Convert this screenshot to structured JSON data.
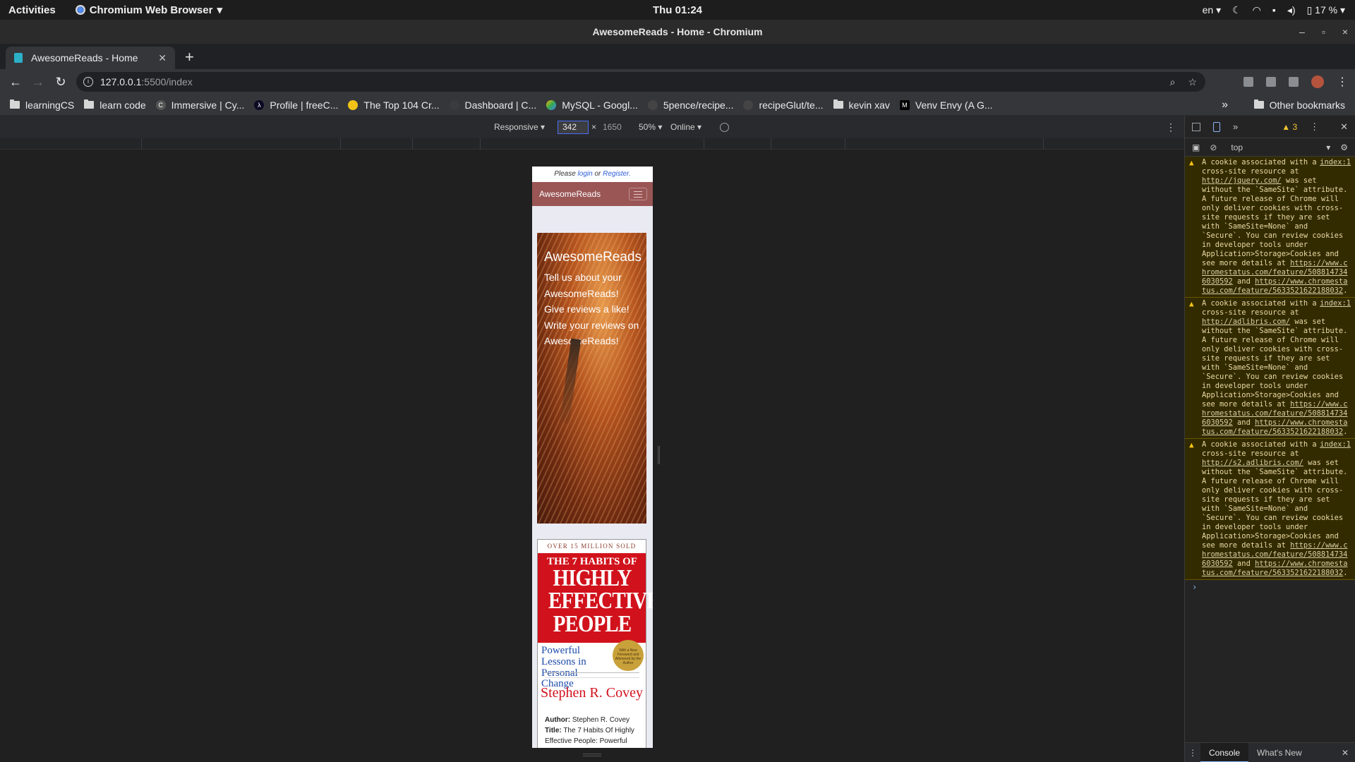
{
  "topbar": {
    "activities": "Activities",
    "app_name": "Chromium Web Browser",
    "clock": "Thu 01:24",
    "language": "en",
    "battery": "17 %"
  },
  "window": {
    "title": "AwesomeReads - Home - Chromium"
  },
  "tabs": [
    {
      "title": "AwesomeReads - Home",
      "active": true
    }
  ],
  "toolbar": {
    "url_host": "127.0.0.1",
    "url_path": ":5500/index"
  },
  "bookmarks": {
    "items": [
      {
        "label": "learningCS",
        "icon": "folder-icon"
      },
      {
        "label": "learn code",
        "icon": "folder-icon"
      },
      {
        "label": "Immersive | Cy...",
        "icon": "site-icon"
      },
      {
        "label": "Profile | freeC...",
        "icon": "freecodecamp-icon"
      },
      {
        "label": "The Top 104 Cr...",
        "icon": "emoji-icon"
      },
      {
        "label": "Dashboard | C...",
        "icon": "site-icon"
      },
      {
        "label": "MySQL - Googl...",
        "icon": "google-drive-icon"
      },
      {
        "label": "5pence/recipe...",
        "icon": "github-icon"
      },
      {
        "label": "recipeGlut/te...",
        "icon": "github-icon"
      },
      {
        "label": "kevin xav",
        "icon": "folder-icon"
      },
      {
        "label": "Venv Envy (A G...",
        "icon": "medium-icon"
      }
    ],
    "overflow": "»",
    "other": "Other bookmarks"
  },
  "device_toolbar": {
    "mode": "Responsive ▾",
    "width": "342",
    "times": "×",
    "height": "1650",
    "zoom": "50% ▾",
    "network": "Online ▾"
  },
  "page": {
    "login_prefix": "Please ",
    "login_link": "login",
    "login_middle": " or ",
    "register_link": "Register.",
    "brand": "AwesomeReads",
    "hero_title": "AwesomeReads",
    "hero_lines": [
      "Tell us about your AwesomeReads!",
      "Give reviews a like!",
      "Write your reviews on AwesomeReads!"
    ],
    "book": {
      "cover_top": "OVER 15 MILLION SOLD",
      "cover_title_1": "THE 7 HABITS OF",
      "cover_title_2": "HIGHLY",
      "cover_title_3": "EFFECTIVE",
      "cover_title_4": "PEOPLE",
      "cover_subtitle": "Powerful Lessons in Personal Change",
      "cover_seal": "With a New Foreword and Afterword by the Author",
      "cover_author": "Stephen R. Covey",
      "author_label": "Author:",
      "author_value": "Stephen R. Covey",
      "title_label": "Title:",
      "title_value": "The 7 Habits Of Highly Effective People: Powerful"
    }
  },
  "devtools": {
    "warning_count": "3",
    "context": "top",
    "messages": [
      {
        "source": "index:1",
        "before": "A cookie associated with a cross-site resource at ",
        "url": "http://jquery.com/",
        "after": " was set without the `SameSite` attribute. A future release of Chrome will only deliver cookies with cross-site requests if they are set with `SameSite=None` and `Secure`. You can review cookies in developer tools under Application>Storage>Cookies and see more details at ",
        "link1": "https://www.chromestatus.com/feature/5088147346030592",
        "and": " and ",
        "link2": "https://www.chromestatus.com/feature/5633521622188032",
        "end": "."
      },
      {
        "source": "index:1",
        "before": "A cookie associated with a cross-site resource at ",
        "url": "http://adlibris.com/",
        "after": " was set without the `SameSite` attribute. A future release of Chrome will only deliver cookies with cross-site requests if they are set with `SameSite=None` and `Secure`. You can review cookies in developer tools under Application>Storage>Cookies and see more details at ",
        "link1": "https://www.chromestatus.com/feature/5088147346030592",
        "and": " and ",
        "link2": "https://www.chromestatus.com/feature/5633521622188032",
        "end": "."
      },
      {
        "source": "index:1",
        "before": "A cookie associated with a cross-site resource at ",
        "url": "http://s2.adlibris.com/",
        "after": " was set without the `SameSite` attribute. A future release of Chrome will only deliver cookies with cross-site requests if they are set with `SameSite=None` and `Secure`. You can review cookies in developer tools under Application>Storage>Cookies and see more details at ",
        "link1": "https://www.chromestatus.com/feature/5088147346030592",
        "and": " and ",
        "link2": "https://www.chromestatus.com/feature/5633521622188032",
        "end": "."
      }
    ],
    "drawer_tabs": [
      "Console",
      "What's New"
    ]
  },
  "colors": {
    "navbar": "#9a5555",
    "warning_bg": "#332b00",
    "cover_red": "#d1121c"
  }
}
